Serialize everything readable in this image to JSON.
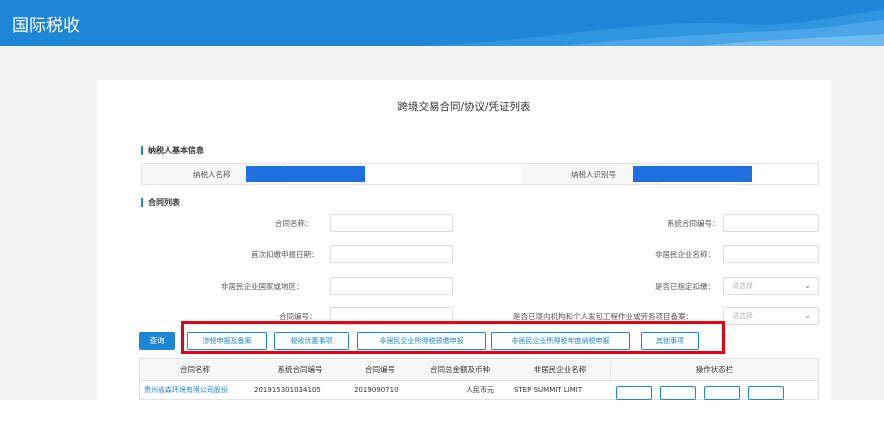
{
  "header": {
    "app_title": "国际税收"
  },
  "page": {
    "title": "跨境交易合同/协议/凭证列表"
  },
  "taxpayer_section": {
    "title": "纳税人基本信息",
    "name_label": "纳税人名称",
    "id_label": "纳税人识别号"
  },
  "contract_section": {
    "title": "合同列表",
    "fields": {
      "contract_name": "合同名称：",
      "system_contract_no": "系统合同编号：",
      "first_withhold_date": "首次扣缴申报日期：",
      "nonresident_name": "非居民企业名称：",
      "nonresident_country": "非居民企业国家或地区：",
      "designated_withhold": "是否已指定扣缴：",
      "contract_no": "合同编号：",
      "filing_label": "是否已境内机构和个人发包工程作业或劳务项目备案："
    },
    "select_placeholder": "请选择"
  },
  "toolbar": {
    "query": "查询",
    "buttons": [
      "涉税申报及备案",
      "税收优惠事项",
      "非居民企业所得税预缴申报",
      "非居民企业所得税年度纳税申报",
      "其他事项"
    ]
  },
  "table": {
    "columns": [
      "合同名称",
      "系统合同编号",
      "合同编号",
      "合同总金额及币种",
      "非居民企业名称",
      "操作状态栏"
    ],
    "row": {
      "name": "贵州省森环境有限公司股份",
      "system_no": "201915301034105",
      "contract_no": "2019090710",
      "amount": "人民币元",
      "company": "STEP SUMMIT LIMIT"
    }
  },
  "colors": {
    "brand": "#1e86d6",
    "highlight": "#e60012",
    "redaction": "#1f6fe0"
  }
}
